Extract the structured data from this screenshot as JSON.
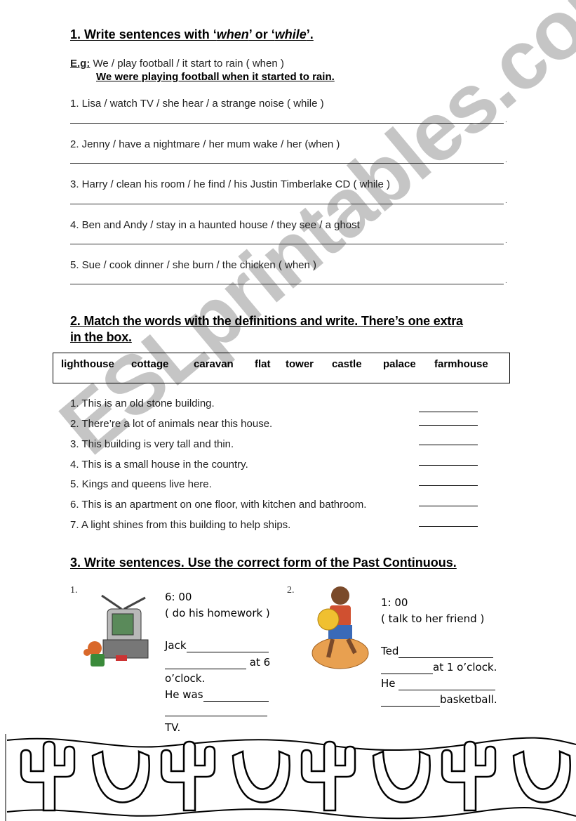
{
  "section1": {
    "title_prefix": "1. Write sentences with ‘",
    "title_when": "when",
    "title_mid": "’ or ‘",
    "title_while": "while",
    "title_suffix": "’.",
    "example_label": "E.g:",
    "example_prompt": " We / play football / it start to rain ( when )",
    "example_answer": "We were playing football when it started to rain.",
    "questions": [
      "1. Lisa / watch TV / she hear / a strange noise ( while )",
      "2. Jenny / have a nightmare / her mum wake / her (when )",
      "3. Harry / clean his room / he find / his Justin Timberlake CD ( while )",
      "4. Ben and Andy / stay in a haunted house / they see / a ghost",
      "5. Sue / cook dinner / she burn / the chicken ( when )"
    ],
    "line_end": "."
  },
  "section2": {
    "title_line1": "2. Match the words with the definitions and write. There’s one extra",
    "title_line2": "in the box.",
    "words": [
      "lighthouse",
      "cottage",
      "caravan",
      "flat",
      "tower",
      "castle",
      "palace",
      "farmhouse"
    ],
    "definitions": [
      "1. This is an old stone building.",
      "2. There’re a lot of animals near this house.",
      "3. This building is very tall and thin.",
      "4. This is a small house in the country.",
      "5. Kings and queens live here.",
      "6. This is an apartment on one floor, with kitchen and bathroom.",
      "7. A light shines from this building to help ships."
    ]
  },
  "section3": {
    "title": "3. Write sentences. Use the correct form of the Past Continuous.",
    "items": [
      {
        "number": "1.",
        "time": "6: 00",
        "cue": "( do his homework )",
        "line1": "Jack",
        "line2_suffix": " at 6",
        "line3": "o’clock.",
        "line4": "He was",
        "line6": "TV."
      },
      {
        "number": "2.",
        "time": "1: 00",
        "cue": "( talk to her friend )",
        "line1": "Ted",
        "line2_suffix": "at 1 o’clock.",
        "line3": "He ",
        "line4_suffix": "basketball."
      }
    ]
  },
  "watermark": "ESLprintables.com",
  "border_decoration": "cactus-horseshoe-border"
}
